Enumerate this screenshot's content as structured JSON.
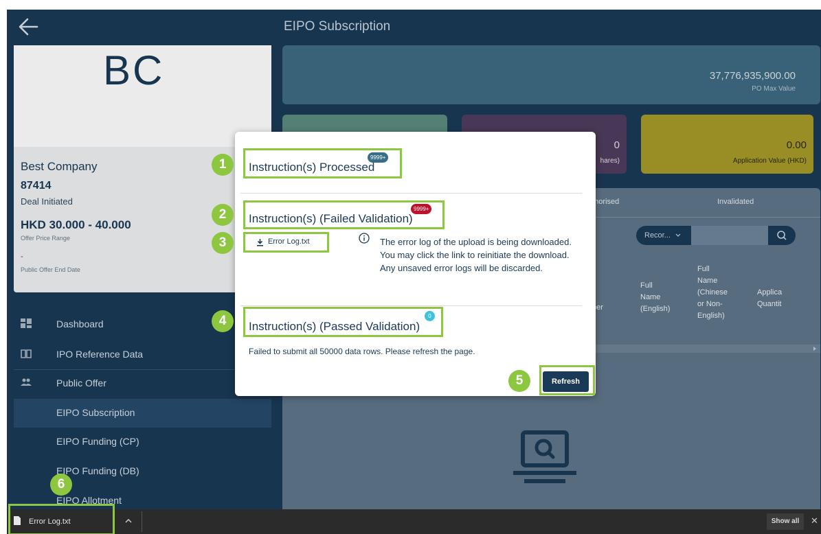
{
  "header": {
    "title": "EIPO Subscription"
  },
  "company": {
    "logo": "BC",
    "name": "Best Company",
    "code": "87414",
    "status": "Deal Initiated",
    "price_range": "HKD 30.000 - 40.000",
    "price_range_label": "Offer Price Range",
    "end_date": "-",
    "end_date_label": "Public Offer End Date"
  },
  "sidebar": {
    "items": [
      {
        "label": "Dashboard",
        "icon": "dashboard-icon"
      },
      {
        "label": "IPO Reference Data",
        "icon": "book-icon"
      },
      {
        "label": "Public Offer",
        "icon": "users-icon"
      },
      {
        "label": "EIPO Subscription"
      },
      {
        "label": "EIPO Funding (CP)"
      },
      {
        "label": "EIPO Funding (DB)"
      },
      {
        "label": "EIPO Allotment"
      }
    ]
  },
  "summary": {
    "max_value": "37,776,935,900.00",
    "max_value_label": "PO Max Value",
    "tiles": [
      {
        "value": "",
        "label": ""
      },
      {
        "value": "0",
        "label": "hares)"
      },
      {
        "value": "0.00",
        "label": "Application Value (HKD)"
      }
    ]
  },
  "table": {
    "tabs": [
      "uthorised",
      "Invalidated"
    ],
    "records_label": "Recor...",
    "headers": {
      "number": "ber",
      "full_name_en": "Full\nName\n(English)",
      "full_name_cn": "Full\nName\n(Chinese\nor Non-\nEnglish)",
      "quantity": "Applica\nQuantit"
    }
  },
  "modal": {
    "processed_title": "Instruction(s) Processed",
    "processed_badge": "9999+",
    "failed_title": "Instruction(s) (Failed Validation)",
    "failed_badge": "9999+",
    "error_link": "Error Log.txt",
    "info_text": "The error log of the upload is being downloaded. You may click the link to reinitiate the download. Any unsaved error logs will be discarded.",
    "passed_title": "Instruction(s) (Passed Validation)",
    "passed_badge": "0",
    "failure_message": "Failed to submit all 50000 data rows. Please refresh the page.",
    "refresh_label": "Refresh"
  },
  "steps": [
    "1",
    "2",
    "3",
    "4",
    "5",
    "6"
  ],
  "download_bar": {
    "file_name": "Error Log.txt",
    "show_all_label": "Show all",
    "close_label": "✕"
  },
  "colors": {
    "navy": "#1b3a57",
    "highlight_green": "#8dc63f",
    "badge_red": "#c0102a",
    "badge_cyan": "#3ec2d9"
  }
}
